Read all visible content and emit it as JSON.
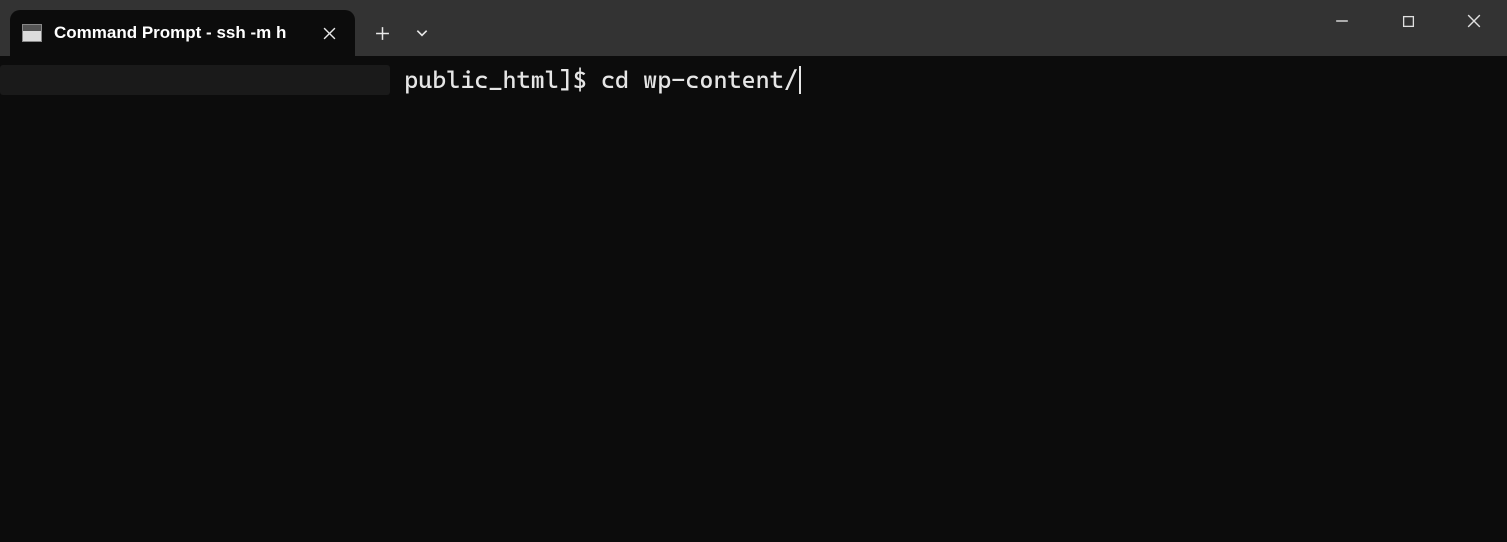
{
  "tab": {
    "title": "Command Prompt - ssh  -m h"
  },
  "terminal": {
    "prompt_suffix": " public_html]$ ",
    "command": "cd wp-content/"
  }
}
